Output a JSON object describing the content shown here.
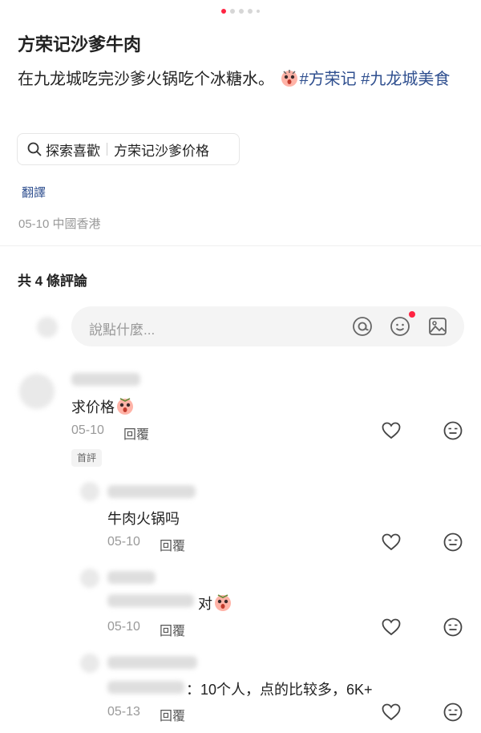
{
  "carousel": {
    "count": 5,
    "active": 0
  },
  "post": {
    "title": "方荣记沙爹牛肉",
    "desc_text": "在九龙城吃完沙爹火锅吃个冰糖水。",
    "tags": [
      "#方荣记",
      "#九龙城美食"
    ],
    "search_chip": {
      "label": "探索喜歡",
      "query": "方荣记沙爹价格"
    },
    "translate": "翻譯",
    "date": "05-10",
    "location": "中國香港"
  },
  "comments_header": {
    "label": "共 4 條評論"
  },
  "input": {
    "placeholder": "說點什麼..."
  },
  "comments": [
    {
      "text": "求价格",
      "date": "05-10",
      "reply": "回覆",
      "badge": "首評"
    },
    {
      "text": "牛肉火锅吗",
      "date": "05-10",
      "reply": "回覆"
    },
    {
      "text": "对",
      "date": "05-10",
      "reply": "回覆"
    },
    {
      "text": "：10个人，点的比较多，6K+",
      "date": "05-13",
      "reply": "回覆"
    }
  ],
  "colors": {
    "accent": "#ff2442",
    "tag": "#2f4f8f",
    "muted": "#999999"
  },
  "icons": [
    "search-icon",
    "at-icon",
    "emoji-icon",
    "image-icon",
    "heart-icon",
    "dislike-face-icon",
    "shocked-face-emoji"
  ]
}
